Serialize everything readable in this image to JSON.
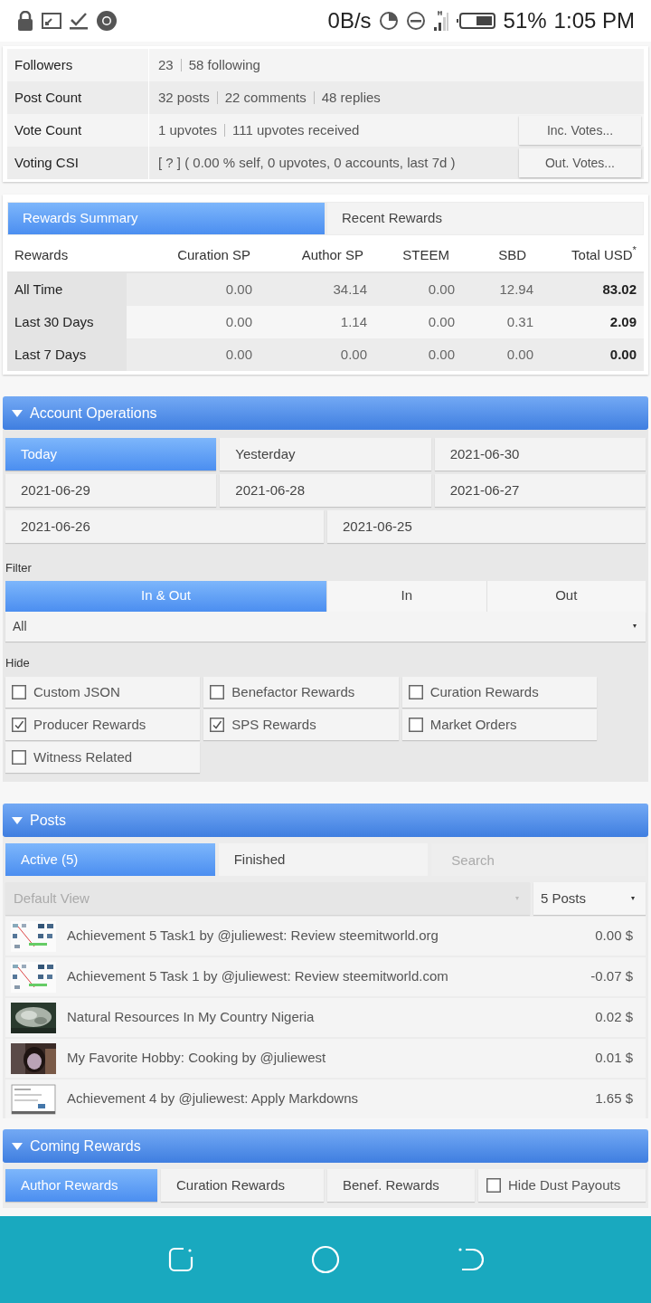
{
  "status_bar": {
    "net_speed": "0B/s",
    "battery": "51%",
    "time": "1:05 PM"
  },
  "profile_rows": [
    {
      "label": "Followers",
      "values": [
        "23",
        "58 following"
      ]
    },
    {
      "label": "Post Count",
      "values": [
        "32 posts",
        "22 comments",
        "48 replies"
      ]
    },
    {
      "label": "Vote Count",
      "values": [
        "1 upvotes",
        "111 upvotes received"
      ],
      "button": "Inc. Votes..."
    },
    {
      "label": "Voting CSI",
      "values": [
        "[ ? ] ( 0.00 % self, 0 upvotes, 0 accounts, last 7d )"
      ],
      "button": "Out. Votes..."
    }
  ],
  "rewards_tabs": [
    {
      "label": "Rewards Summary",
      "selected": true
    },
    {
      "label": "Recent Rewards",
      "selected": false
    }
  ],
  "rewards_table": {
    "columns": [
      "Rewards",
      "Curation SP",
      "Author SP",
      "STEEM",
      "SBD",
      "Total USD$^{*}$"
    ],
    "rows": [
      {
        "cells": [
          "All Time",
          "0.00",
          "34.14",
          "0.00",
          "12.94",
          "83.02"
        ]
      },
      {
        "cells": [
          "Last 30 Days",
          "0.00",
          "1.14",
          "0.00",
          "0.31",
          "2.09"
        ]
      },
      {
        "cells": [
          "Last 7 Days",
          "0.00",
          "0.00",
          "0.00",
          "0.00",
          "0.00"
        ]
      }
    ]
  },
  "account_operations": {
    "title": "Account Operations",
    "expanded": true,
    "day_rows": [
      [
        {
          "label": "Today",
          "selected": true
        },
        {
          "label": "Yesterday",
          "selected": false
        },
        {
          "label": "2021-06-30",
          "selected": false
        }
      ],
      [
        {
          "label": "2021-06-29",
          "selected": false
        },
        {
          "label": "2021-06-28",
          "selected": false
        },
        {
          "label": "2021-06-27",
          "selected": false
        }
      ],
      [
        {
          "label": "2021-06-26",
          "selected": false
        },
        {
          "label": "2021-06-25",
          "selected": false
        }
      ]
    ],
    "filter_label": "Filter",
    "filter_tabs": [
      {
        "label": "In & Out",
        "selected": true
      },
      {
        "label": "In",
        "selected": false
      },
      {
        "label": "Out",
        "selected": false
      }
    ],
    "type_select": {
      "value": "All"
    },
    "hide_label": "Hide",
    "hide_options": [
      {
        "label": "Custom JSON",
        "checked": false
      },
      {
        "label": "Benefactor Rewards",
        "checked": false
      },
      {
        "label": "Curation Rewards",
        "checked": false
      },
      {
        "label": "Producer Rewards",
        "checked": true
      },
      {
        "label": "SPS Rewards",
        "checked": true
      },
      {
        "label": "Market Orders",
        "checked": false
      },
      {
        "label": "Witness Related",
        "checked": false
      }
    ]
  },
  "posts": {
    "title": "Posts",
    "expanded": true,
    "tabs": [
      {
        "label": "Active (5)",
        "selected": true
      },
      {
        "label": "Finished",
        "selected": false
      }
    ],
    "search": {
      "placeholder": "Search"
    },
    "view_select": {
      "placeholder": "Default View"
    },
    "count_select": {
      "value": "5 Posts"
    },
    "items": [
      {
        "title": "Achievement 5 Task1 by @juliewest: Review steemitworld.org",
        "payout": "0.00 $",
        "kind": "picture"
      },
      {
        "title": "Achievement 5 Task 1 by @juliewest: Review steemitworld.com",
        "payout": "-0.07 $",
        "kind": "picture"
      },
      {
        "title": "Natural Resources In My Country Nigeria",
        "payout": "0.02 $",
        "kind": "picture"
      },
      {
        "title": "My Favorite Hobby: Cooking by @juliewest",
        "payout": "0.01 $",
        "kind": "picture"
      },
      {
        "title": "Achievement 4 by @juliewest: Apply Markdowns",
        "payout": "1.65 $",
        "kind": "picture"
      }
    ]
  },
  "coming_rewards": {
    "title": "Coming Rewards",
    "expanded": true,
    "tabs": [
      {
        "label": "Author Rewards",
        "selected": true
      },
      {
        "label": "Curation Rewards",
        "selected": false
      },
      {
        "label": "Benef. Rewards",
        "selected": false
      }
    ],
    "hide_dust": {
      "label": "Hide Dust Payouts",
      "checked": false
    }
  }
}
